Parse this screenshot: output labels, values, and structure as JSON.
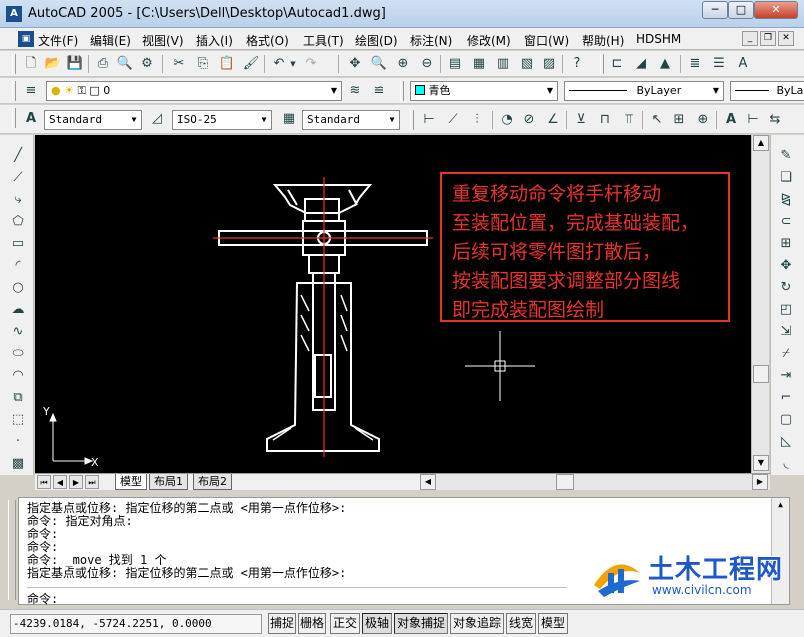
{
  "window": {
    "title": "AutoCAD 2005 - [C:\\Users\\Dell\\Desktop\\Autocad1.dwg]",
    "app_icon": "autocad-logo-icon",
    "controls": [
      "minimize-icon",
      "maximize-icon",
      "close-icon"
    ]
  },
  "menu": {
    "items": [
      "文件(F)",
      "编辑(E)",
      "视图(V)",
      "插入(I)",
      "格式(O)",
      "工具(T)",
      "绘图(D)",
      "标注(N)",
      "修改(M)",
      "窗口(W)",
      "帮助(H)",
      "HDSHM"
    ]
  },
  "layers_toolbar": {
    "layer_value": "0",
    "color_value": "青色",
    "linetype_value": "ByLayer",
    "lineweight_value": "ByLa"
  },
  "styles_toolbar": {
    "text_style": "Standard",
    "dim_style": "ISO-25",
    "table_style": "Standard"
  },
  "annotation": {
    "lines": [
      "重复移动命令将手杆移动",
      "至装配位置，完成基础装配，",
      "后续可将零件图打散后，",
      "按装配图要求调整部分图线",
      "即完成装配图绘制"
    ],
    "color": "#e8322c"
  },
  "ucs": {
    "x_label": "X",
    "y_label": "Y"
  },
  "layout_tabs": [
    "模型",
    "布局1",
    "布局2"
  ],
  "command_history": [
    "指定基点或位移: 指定位移的第二点或 <用第一点作位移>:",
    "命令: 指定对角点:",
    "命令:",
    "命令:",
    "命令: _move 找到 1 个",
    "指定基点或位移: 指定位移的第二点或 <用第一点作位移>:"
  ],
  "command_prompt": "命令:",
  "status": {
    "coordinates": "-4239.0184, -5724.2251, 0.0000",
    "toggles": [
      {
        "label": "捕捉",
        "on": false
      },
      {
        "label": "栅格",
        "on": false
      },
      {
        "label": "正交",
        "on": false
      },
      {
        "label": "极轴",
        "on": true
      },
      {
        "label": "对象捕捉",
        "on": true
      },
      {
        "label": "对象追踪",
        "on": false
      },
      {
        "label": "线宽",
        "on": false
      },
      {
        "label": "模型",
        "on": false
      }
    ]
  },
  "watermark": {
    "title": "土木工程网",
    "url": "www.civilcn.com"
  }
}
